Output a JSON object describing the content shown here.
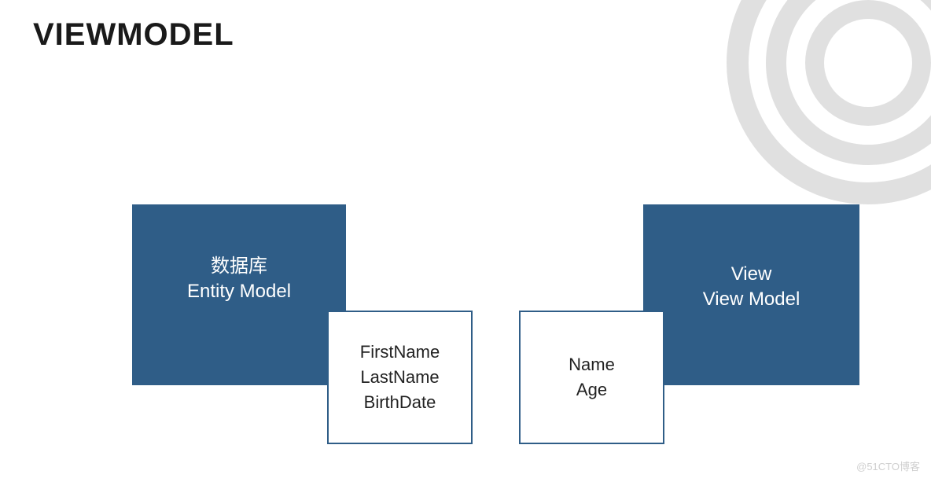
{
  "title": "VIEWMODEL",
  "leftBox": {
    "line1": "数据库",
    "line2": "Entity Model"
  },
  "rightBox": {
    "line1": "View",
    "line2": "View Model"
  },
  "entityFields": {
    "line1": "FirstName",
    "line2": "LastName",
    "line3": "BirthDate"
  },
  "viewFields": {
    "line1": "Name",
    "line2": "Age"
  },
  "watermark": "@51CTO博客"
}
